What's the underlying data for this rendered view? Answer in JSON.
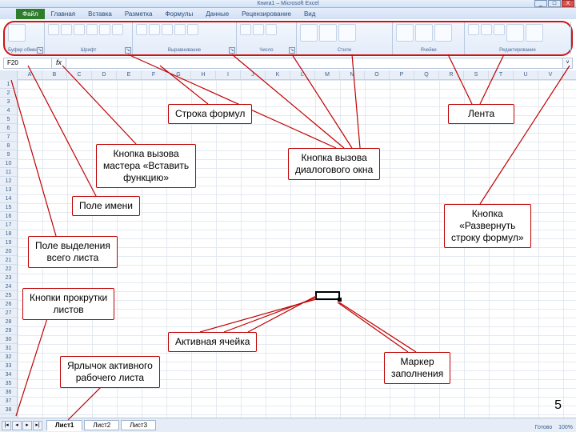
{
  "window": {
    "title": "Книга1 – Microsoft Excel",
    "min": "_",
    "max": "□",
    "close": "X"
  },
  "tabs": {
    "file": "Файл",
    "items": [
      "Главная",
      "Вставка",
      "Разметка",
      "Формулы",
      "Данные",
      "Рецензирование",
      "Вид"
    ]
  },
  "ribbon": {
    "groups": [
      "Буфер обмена",
      "Шрифт",
      "Выравнивание",
      "Число",
      "Стили",
      "Ячейки",
      "Редактирование"
    ],
    "launcher": "↘"
  },
  "formula_bar": {
    "name_box": "F20",
    "fx": "fx",
    "expand": "˅"
  },
  "columns": [
    "A",
    "B",
    "C",
    "D",
    "E",
    "F",
    "G",
    "H",
    "I",
    "J",
    "K",
    "L",
    "M",
    "N",
    "O",
    "P",
    "Q",
    "R",
    "S",
    "T",
    "U",
    "V"
  ],
  "rows_count": 38,
  "sheet_tabs": {
    "scroll": [
      "|◂",
      "◂",
      "▸",
      "▸|"
    ],
    "tabs": [
      "Лист1",
      "Лист2",
      "Лист3"
    ],
    "active_index": 0
  },
  "status": {
    "ready": "Готово",
    "zoom": "100%"
  },
  "callouts": {
    "formula_bar": "Строка формул",
    "ribbon": "Лента",
    "fx_button": "Кнопка вызова\nмастера «Вставить\nфункцию»",
    "dialog_launcher": "Кнопка вызова\nдиалогового окна",
    "name_box": "Поле имени",
    "expand_formula": "Кнопка\n«Развернуть\nстроку формул»",
    "select_all": "Поле выделения\nвсего листа",
    "scroll_buttons": "Кнопки прокрутки\nлистов",
    "active_cell": "Активная ячейка",
    "active_tab": "Ярлычок активного\nрабочего листа",
    "fill_handle": "Маркер\nзаполнения"
  },
  "page_number": "5"
}
